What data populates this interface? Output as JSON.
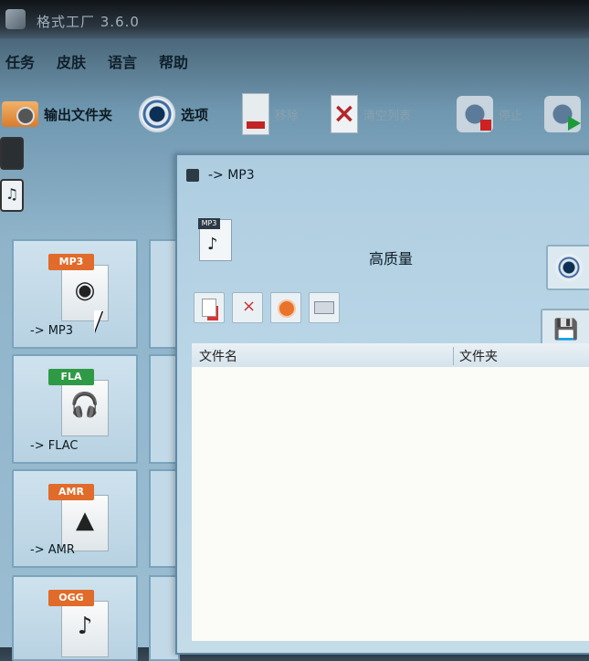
{
  "app": {
    "title": "格式工厂 3.6.0"
  },
  "menu": [
    "任务",
    "皮肤",
    "语言",
    "帮助"
  ],
  "toolbar": {
    "output_folder": "输出文件夹",
    "options": "选项",
    "remove": "移除",
    "clear_list": "清空列表",
    "stop": "停止"
  },
  "formats": [
    {
      "label": "-> MP3",
      "tag": "MP3",
      "tag_color": "#e06b2a",
      "glyph": "◉"
    },
    {
      "label": "-> FLAC",
      "tag": "FLA",
      "tag_color": "#2f9a45",
      "glyph": "🎧"
    },
    {
      "label": "-> AMR",
      "tag": "AMR",
      "tag_color": "#e06b2a",
      "glyph": "▲"
    },
    {
      "label": "",
      "tag": "OGG",
      "tag_color": "#e06b2a",
      "glyph": "♪"
    }
  ],
  "dialog": {
    "title": "-> MP3",
    "file_icon_tag": "MP3",
    "quality": "高质量",
    "columns": {
      "filename": "文件名",
      "folder": "文件夹"
    }
  }
}
